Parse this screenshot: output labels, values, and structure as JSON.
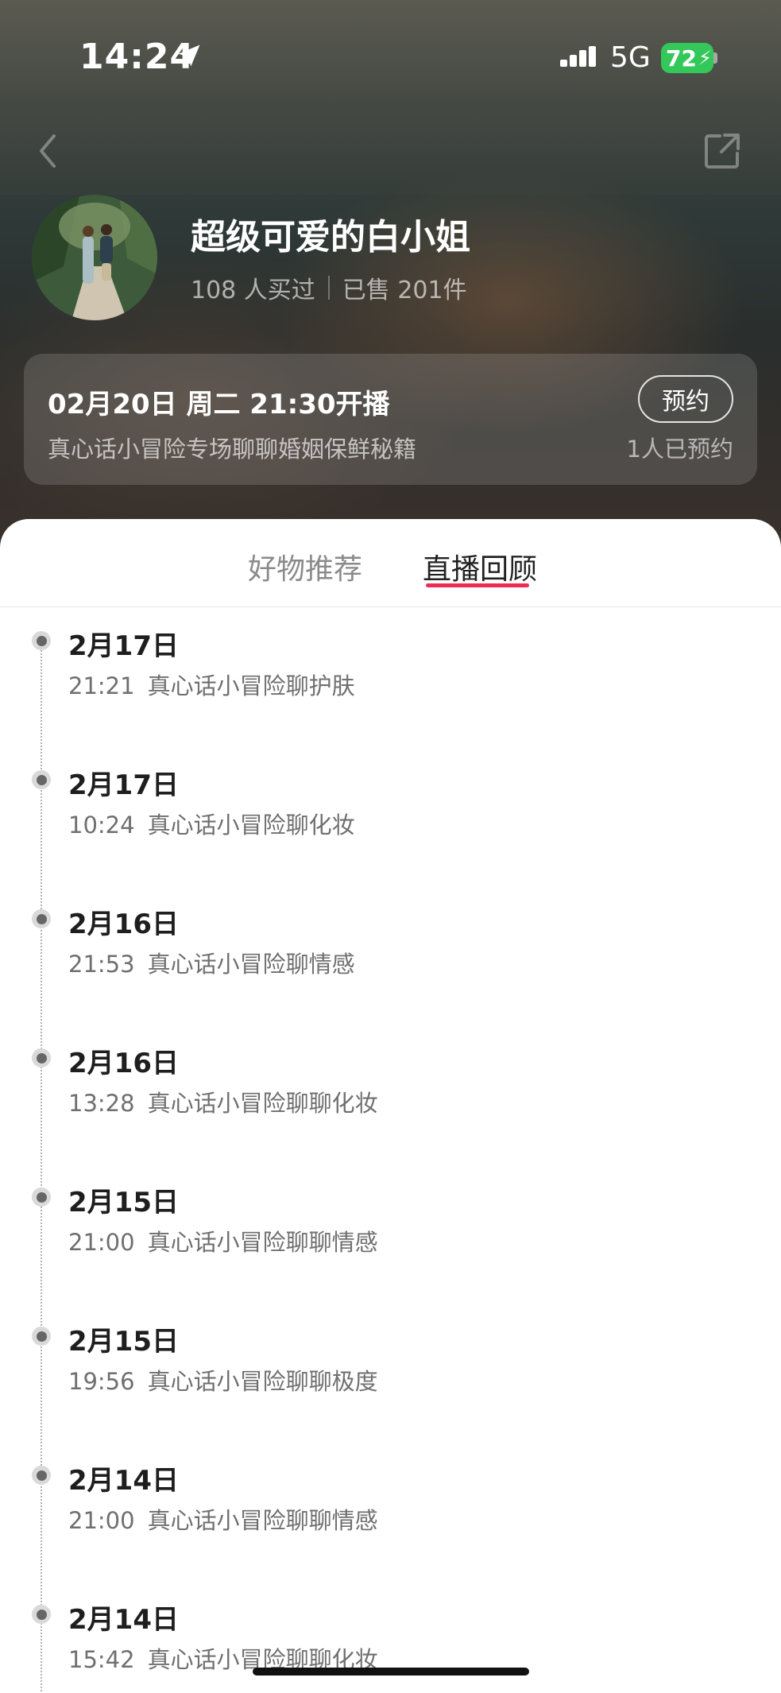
{
  "status_bar": {
    "time": "14:24",
    "network": "5G",
    "battery": "72"
  },
  "profile": {
    "name": "超级可爱的白小姐",
    "bought": "108 人买过",
    "sold": "已售 201件"
  },
  "live_card": {
    "time": "02月20日 周二 21:30开播",
    "topic": "真心话小冒险专场聊聊婚姻保鲜秘籍",
    "reserve_label": "预约",
    "reserve_count": "1人已预约"
  },
  "tabs": [
    {
      "label": "好物推荐",
      "active": false
    },
    {
      "label": "直播回顾",
      "active": true
    }
  ],
  "timeline": [
    {
      "date": "2月17日",
      "time": "21:21",
      "title": "真心话小冒险聊护肤"
    },
    {
      "date": "2月17日",
      "time": "10:24",
      "title": "真心话小冒险聊化妆"
    },
    {
      "date": "2月16日",
      "time": "21:53",
      "title": "真心话小冒险聊情感"
    },
    {
      "date": "2月16日",
      "time": "13:28",
      "title": "真心话小冒险聊聊化妆"
    },
    {
      "date": "2月15日",
      "time": "21:00",
      "title": "真心话小冒险聊聊情感"
    },
    {
      "date": "2月15日",
      "time": "19:56",
      "title": "真心话小冒险聊聊极度"
    },
    {
      "date": "2月14日",
      "time": "21:00",
      "title": "真心话小冒险聊聊情感"
    },
    {
      "date": "2月14日",
      "time": "15:42",
      "title": "真心话小冒险聊聊化妆"
    }
  ],
  "colors": {
    "tab_accent": "#ef2b4f",
    "battery": "#34c759"
  }
}
